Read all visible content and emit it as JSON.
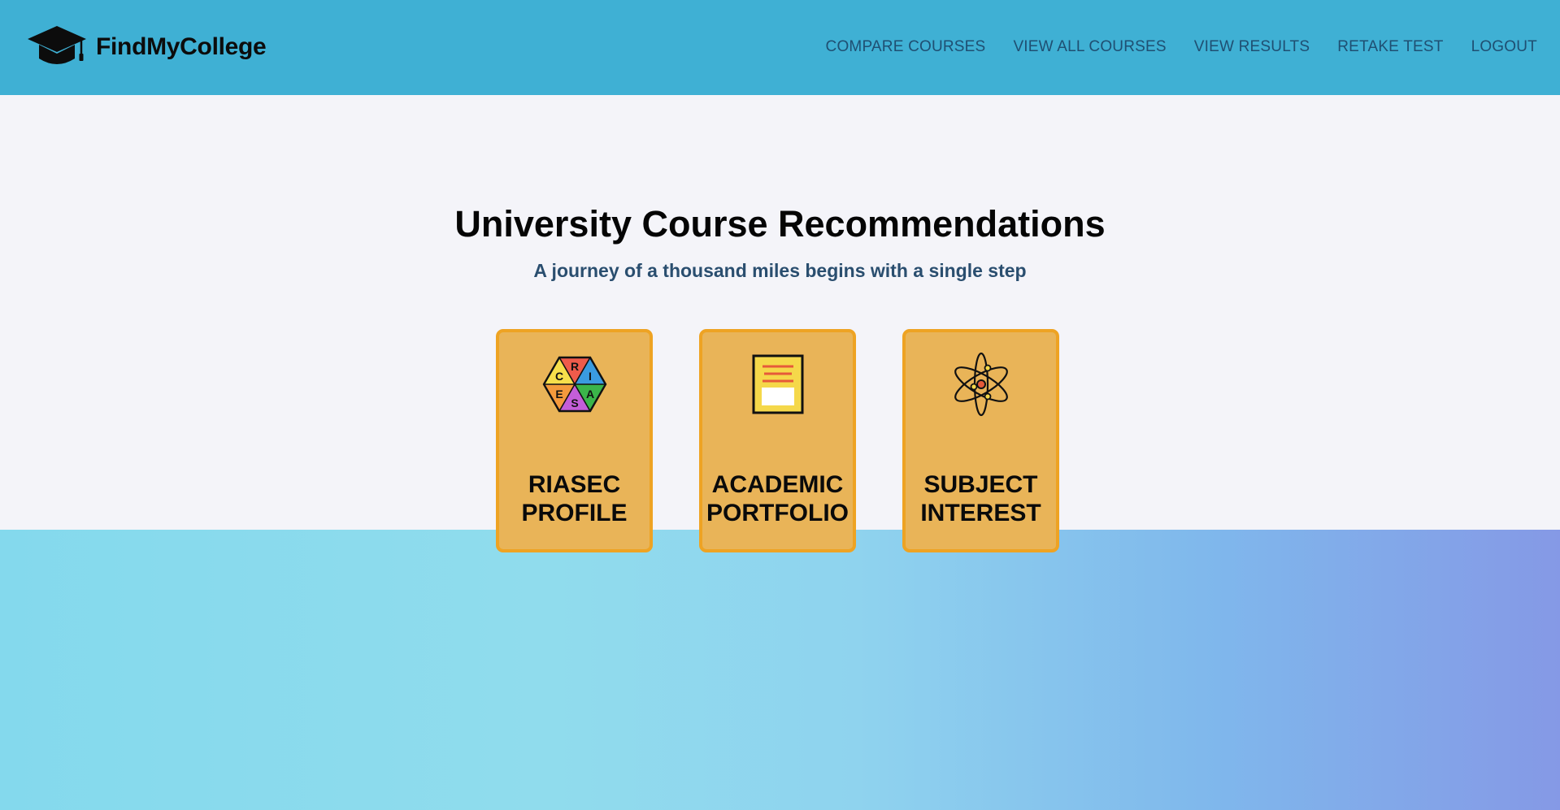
{
  "header": {
    "brand_name": "FindMyCollege",
    "logo_icon": "graduation-cap-icon",
    "nav": [
      {
        "label": "COMPARE COURSES"
      },
      {
        "label": "VIEW ALL COURSES"
      },
      {
        "label": "VIEW RESULTS"
      },
      {
        "label": "RETAKE TEST"
      },
      {
        "label": "LOGOUT"
      }
    ],
    "colors": {
      "background": "#3fb0d4",
      "nav_text": "#1f4f72"
    }
  },
  "main": {
    "title": "University Course Recommendations",
    "subtitle": "A journey of a thousand miles begins with a single step",
    "cards": [
      {
        "label": "RIASEC\nPROFILE",
        "icon": "riasec-hexagon-icon",
        "hex_letters": [
          "R",
          "I",
          "A",
          "S",
          "E",
          "C"
        ]
      },
      {
        "label": "ACADEMIC\nPORTFOLIO",
        "icon": "document-icon"
      },
      {
        "label": "SUBJECT\nINTEREST",
        "icon": "atom-icon"
      }
    ],
    "colors": {
      "card_fill": "#e9b458",
      "card_border": "#eea323"
    }
  }
}
